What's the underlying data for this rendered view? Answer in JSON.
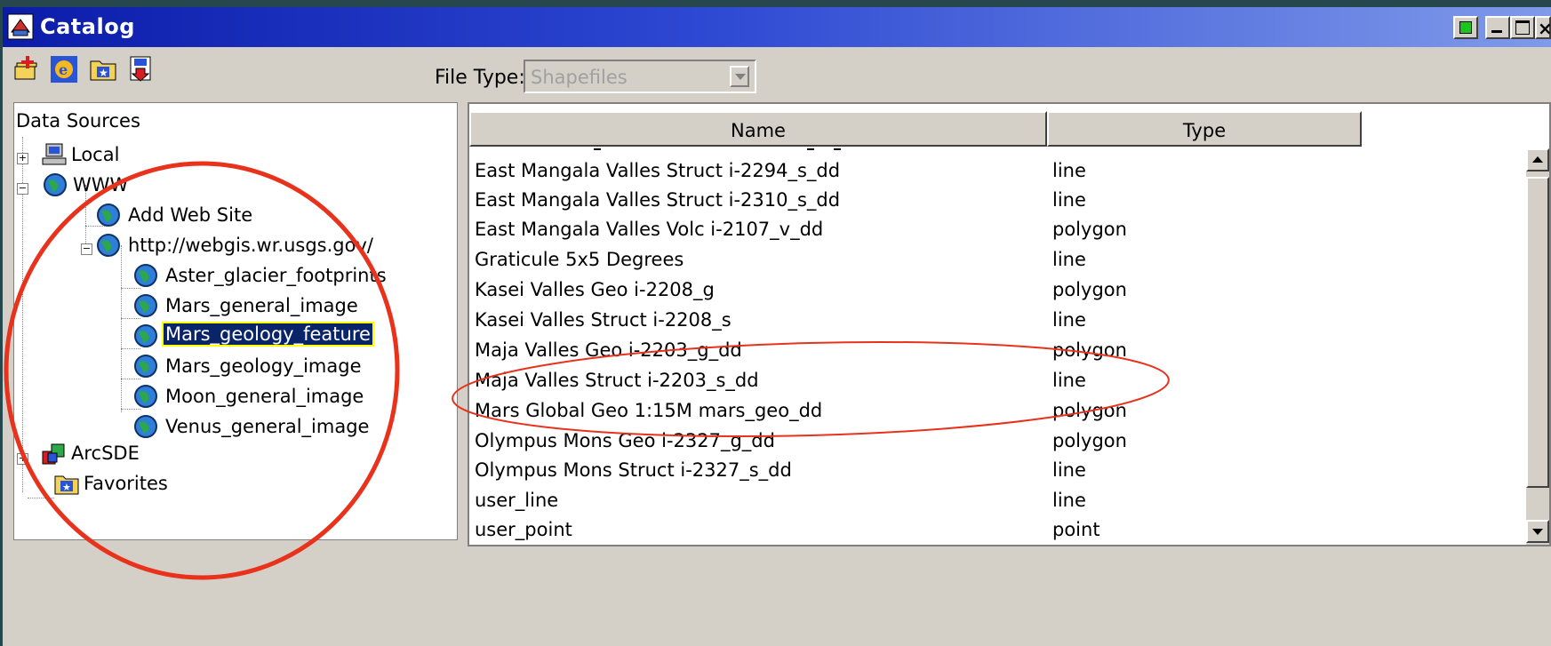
{
  "window": {
    "title": "Catalog"
  },
  "toolbar": {
    "icons": [
      "add-data-icon",
      "internet-explorer-icon",
      "folder-favorites-icon",
      "save-down-icon"
    ],
    "file_type_label": "File Type:",
    "file_type_value": "Shapefiles"
  },
  "tree": {
    "root": "Data Sources",
    "local": "Local",
    "www": "WWW",
    "add_web_site": "Add Web Site",
    "server": "http://webgis.wr.usgs.gov/",
    "services": [
      "Aster_glacier_footprints",
      "Mars_general_image",
      "Mars_geology_feature",
      "Mars_geology_image",
      "Moon_general_image",
      "Venus_general_image"
    ],
    "selected": "Mars_geology_feature",
    "arcsde": "ArcSDE",
    "favorites": "Favorites"
  },
  "list": {
    "columns": [
      "Name",
      "Type"
    ],
    "rows": [
      {
        "name": "East Mangala Valles Struct i-2294_s_dd",
        "type": "line"
      },
      {
        "name": "East Mangala Valles Struct i-2310_s_dd",
        "type": "line"
      },
      {
        "name": "East Mangala Valles Volc i-2107_v_dd",
        "type": "polygon"
      },
      {
        "name": "Graticule 5x5 Degrees",
        "type": "line"
      },
      {
        "name": "Kasei Valles Geo i-2208_g",
        "type": "polygon"
      },
      {
        "name": "Kasei Valles Struct i-2208_s",
        "type": "line"
      },
      {
        "name": "Maja Valles Geo i-2203_g_dd",
        "type": "polygon"
      },
      {
        "name": "Maja Valles Struct i-2203_s_dd",
        "type": "line"
      },
      {
        "name": "Mars Global Geo 1:15M mars_geo_dd",
        "type": "polygon"
      },
      {
        "name": "Olympus Mons Geo i-2327_g_dd",
        "type": "polygon"
      },
      {
        "name": "Olympus Mons Struct i-2327_s_dd",
        "type": "line"
      },
      {
        "name": "user_line",
        "type": "line"
      },
      {
        "name": "user_point",
        "type": "point"
      }
    ]
  },
  "colors": {
    "titlebar_start": "#0b1ca9",
    "titlebar_end": "#7f9ae9",
    "selection": "#0a246a",
    "annotation": "#e8321c",
    "background": "#27474f"
  }
}
